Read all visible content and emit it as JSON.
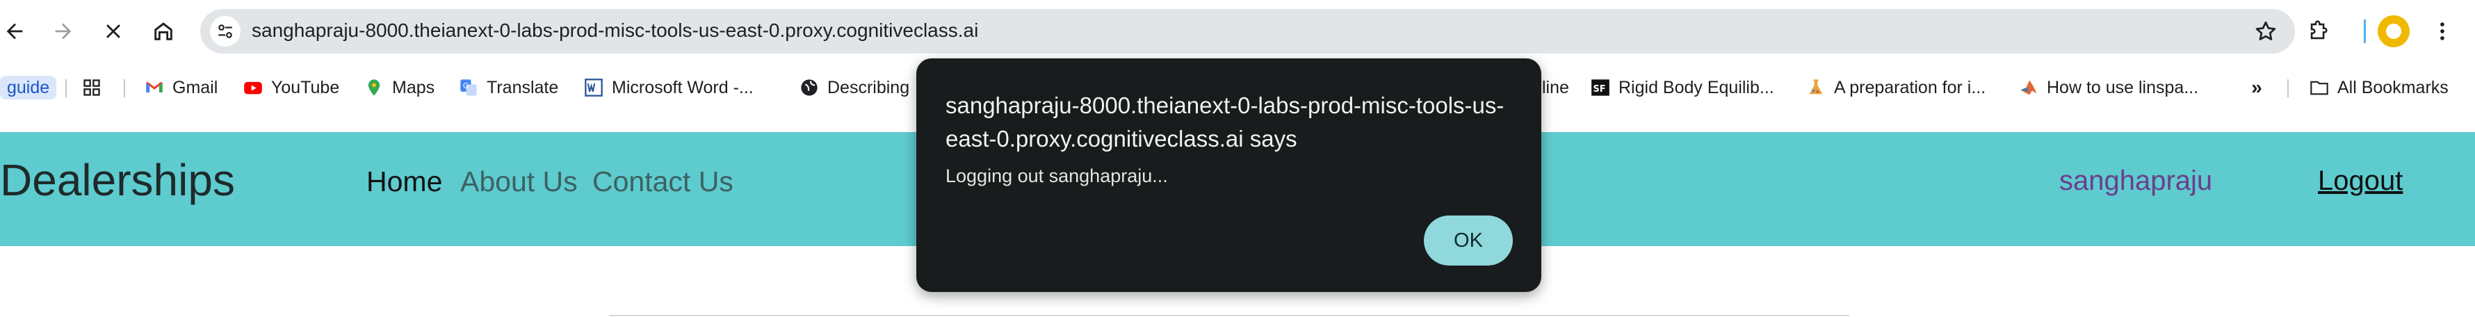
{
  "browser": {
    "url": "sanghapraju-8000.theianext-0-labs-prod-misc-tools-us-east-0.proxy.cognitiveclass.ai",
    "icons": {
      "back": "arrow-left-icon",
      "forward": "arrow-right-icon",
      "stop": "close-icon",
      "home": "home-icon",
      "site_info": "tune-icon",
      "bookmark": "star-icon",
      "extensions": "puzzle-icon",
      "menu": "more-vert-icon"
    }
  },
  "bookmarks": {
    "guide": "guide",
    "items": [
      {
        "label": "Gmail",
        "icon": "gmail-icon",
        "color": "#ea4335"
      },
      {
        "label": "YouTube",
        "icon": "youtube-icon",
        "color": "#ff0000"
      },
      {
        "label": "Maps",
        "icon": "maps-pin-icon",
        "color": "#34a853"
      },
      {
        "label": "Translate",
        "icon": "translate-icon",
        "color": "#4285f4"
      },
      {
        "label": "Microsoft Word -...",
        "icon": "word-icon",
        "color": "#2b579a"
      },
      {
        "label": "Describing",
        "icon": "globe-icon",
        "color": "#202124"
      },
      {
        "label": "line",
        "icon": "",
        "color": ""
      },
      {
        "label": "Rigid Body Equilib...",
        "icon": "sf-icon",
        "color": "#111111"
      },
      {
        "label": "A preparation for i...",
        "icon": "flask-icon",
        "color": "#e8a33d"
      },
      {
        "label": "How to use linspa...",
        "icon": "matlab-icon",
        "color": "#e16737"
      }
    ],
    "more": "»",
    "all_bookmarks": "All Bookmarks"
  },
  "page": {
    "brand": "Dealerships",
    "nav": {
      "home": "Home",
      "about": "About Us",
      "contact": "Contact Us"
    },
    "username": "sanghapraju",
    "logout": "Logout",
    "navbar_color": "#5ecbcf"
  },
  "dialog": {
    "title": "sanghapraju-8000.theianext-0-labs-prod-misc-tools-us-east-0.proxy.cognitiveclass.ai says",
    "message": "Logging out sanghapraju...",
    "ok": "OK"
  }
}
